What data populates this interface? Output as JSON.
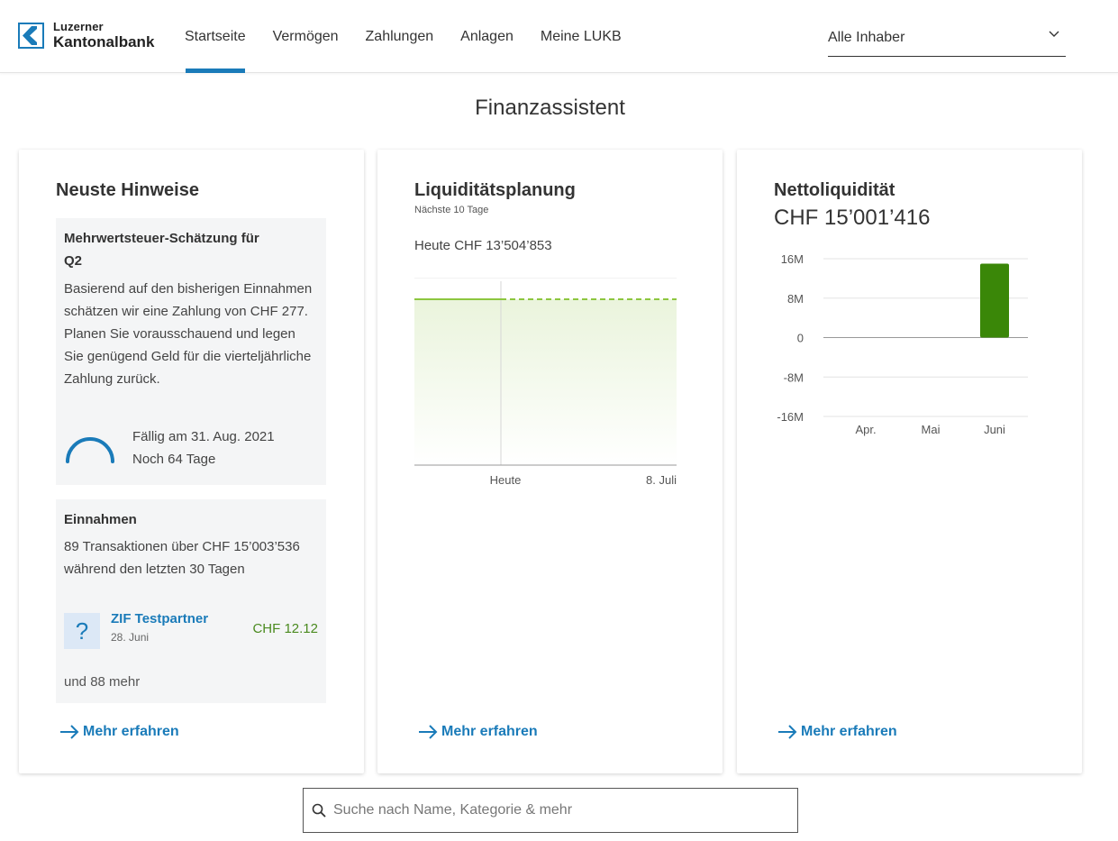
{
  "header": {
    "logo": {
      "line1": "Luzerner",
      "line2": "Kantonalbank",
      "icon": "lukb-logo-icon"
    },
    "nav": [
      {
        "label": "Startseite",
        "active": true
      },
      {
        "label": "Vermögen",
        "active": false
      },
      {
        "label": "Zahlungen",
        "active": false
      },
      {
        "label": "Anlagen",
        "active": false
      },
      {
        "label": "Meine LUKB",
        "active": false
      }
    ],
    "owner_select": {
      "value": "Alle Inhaber",
      "icon": "chevron-down-icon"
    }
  },
  "page": {
    "title": "Finanzassistent"
  },
  "cards": {
    "hints": {
      "title": "Neuste Hinweise",
      "vat": {
        "title": "Mehrwertsteuer-Schätzung für Q2",
        "text": "Basierend auf den bisherigen Einnahmen schätzen wir eine Zahlung von CHF 277. Planen Sie vorausschauend und legen Sie genügend Geld für die vierteljährliche Zahlung zurück.",
        "due_label": "Fällig am 31. Aug. 2021",
        "days_left": "Noch 64 Tage",
        "progress_icon": "progress-arc-icon"
      },
      "income": {
        "title": "Einnahmen",
        "text": "89 Transaktionen über CHF 15’003’536 während den letzten 30 Tagen",
        "transaction": {
          "icon": "question-icon",
          "icon_glyph": "?",
          "name": "ZIF Testpartner",
          "date": "28. Juni",
          "amount": "CHF 12.12"
        },
        "more": "und 88 mehr"
      },
      "more_link": "Mehr erfahren"
    },
    "liquidity": {
      "title": "Liquiditätsplanung",
      "subtitle": "Nächste 10 Tage",
      "today_value": "Heute CHF 13’504’853",
      "more_link": "Mehr erfahren"
    },
    "net": {
      "title": "Nettoliquidität",
      "value": "CHF 15’001’416",
      "more_link": "Mehr erfahren"
    }
  },
  "chart_data": [
    {
      "type": "area",
      "title": "Liquiditätsplanung",
      "x_tick_labels": [
        "Heute",
        "8. Juli"
      ],
      "series": [
        {
          "style": "solid",
          "values": [
            13504853,
            13504853
          ]
        },
        {
          "style": "dashed",
          "values": [
            13504853,
            13504853
          ]
        }
      ],
      "grid": true,
      "colors": {
        "line": "#8dc63f",
        "fill": "#eef6e3"
      }
    },
    {
      "type": "bar",
      "title": "Nettoliquidität",
      "categories": [
        "Apr.",
        "Mai",
        "Juni"
      ],
      "values": [
        0,
        0,
        15001416
      ],
      "y_tick_labels": [
        "16M",
        "8M",
        "0",
        "-8M",
        "-16M"
      ],
      "ylim": [
        -16000000,
        16000000
      ],
      "grid": true,
      "colors": {
        "bar": "#3a8708"
      }
    }
  ],
  "search": {
    "placeholder": "Suche nach Name, Kategorie & mehr",
    "icon": "search-icon"
  },
  "colors": {
    "accent": "#1a7bb9",
    "positive": "#4a8a1f",
    "bar": "#3a8708"
  }
}
